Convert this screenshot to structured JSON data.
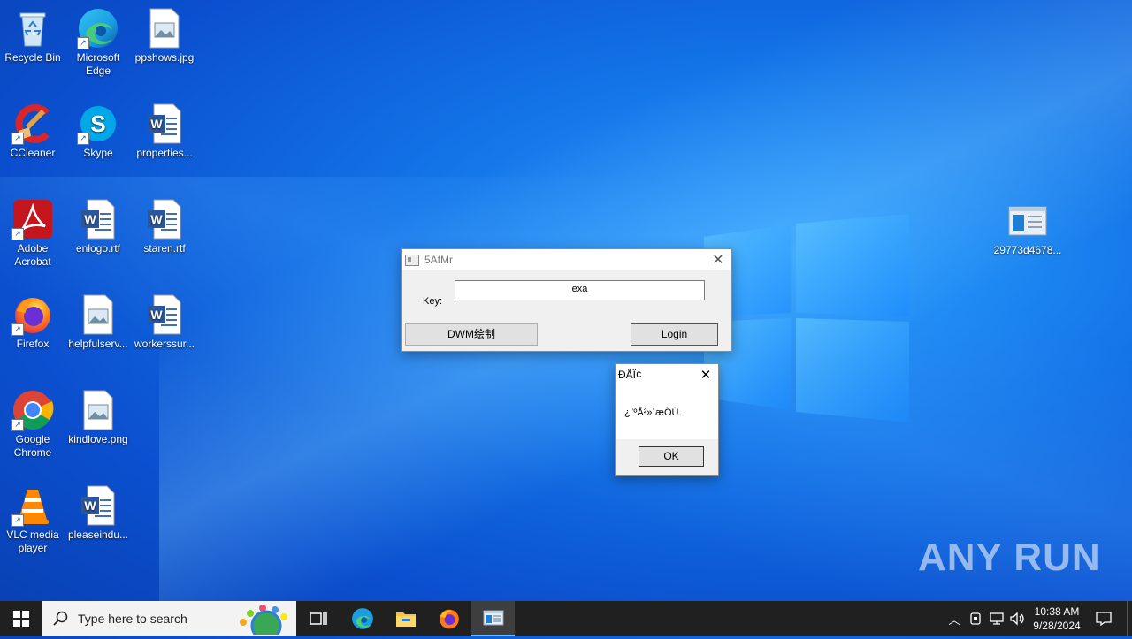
{
  "desktop": {
    "icons": [
      {
        "label": "Recycle Bin",
        "icon": "recycle-bin-icon"
      },
      {
        "label": "Microsoft Edge",
        "icon": "edge-icon"
      },
      {
        "label": "ppshows.jpg",
        "icon": "image-file-icon"
      },
      {
        "label": "CCleaner",
        "icon": "ccleaner-icon"
      },
      {
        "label": "Skype",
        "icon": "skype-icon"
      },
      {
        "label": "properties...",
        "icon": "word-doc-icon"
      },
      {
        "label": "Adobe Acrobat",
        "icon": "acrobat-icon"
      },
      {
        "label": "enlogo.rtf",
        "icon": "word-doc-icon"
      },
      {
        "label": "staren.rtf",
        "icon": "word-doc-icon"
      },
      {
        "label": "Firefox",
        "icon": "firefox-icon"
      },
      {
        "label": "helpfulserv...",
        "icon": "image-file-icon"
      },
      {
        "label": "workerssur...",
        "icon": "word-doc-icon"
      },
      {
        "label": "Google Chrome",
        "icon": "chrome-icon"
      },
      {
        "label": "kindlove.png",
        "icon": "image-file-icon"
      },
      {
        "label": "VLC media player",
        "icon": "vlc-icon"
      },
      {
        "label": "pleaseindu...",
        "icon": "word-doc-icon"
      },
      {
        "label": "29773d4678...",
        "icon": "app-window-icon"
      }
    ]
  },
  "login_window": {
    "title": "5AfMr",
    "key_label": "Key:",
    "key_value": "exa",
    "dwm_button": "DWM绘制",
    "login_button": "Login"
  },
  "message_box": {
    "title": "ÐÅÏ¢",
    "message": "¿¨ºÅ²»´æÔÚ.",
    "ok_button": "OK"
  },
  "taskbar": {
    "search_placeholder": "Type here to search",
    "time": "10:38 AM",
    "date": "9/28/2024"
  },
  "watermark": "ANY RUN"
}
